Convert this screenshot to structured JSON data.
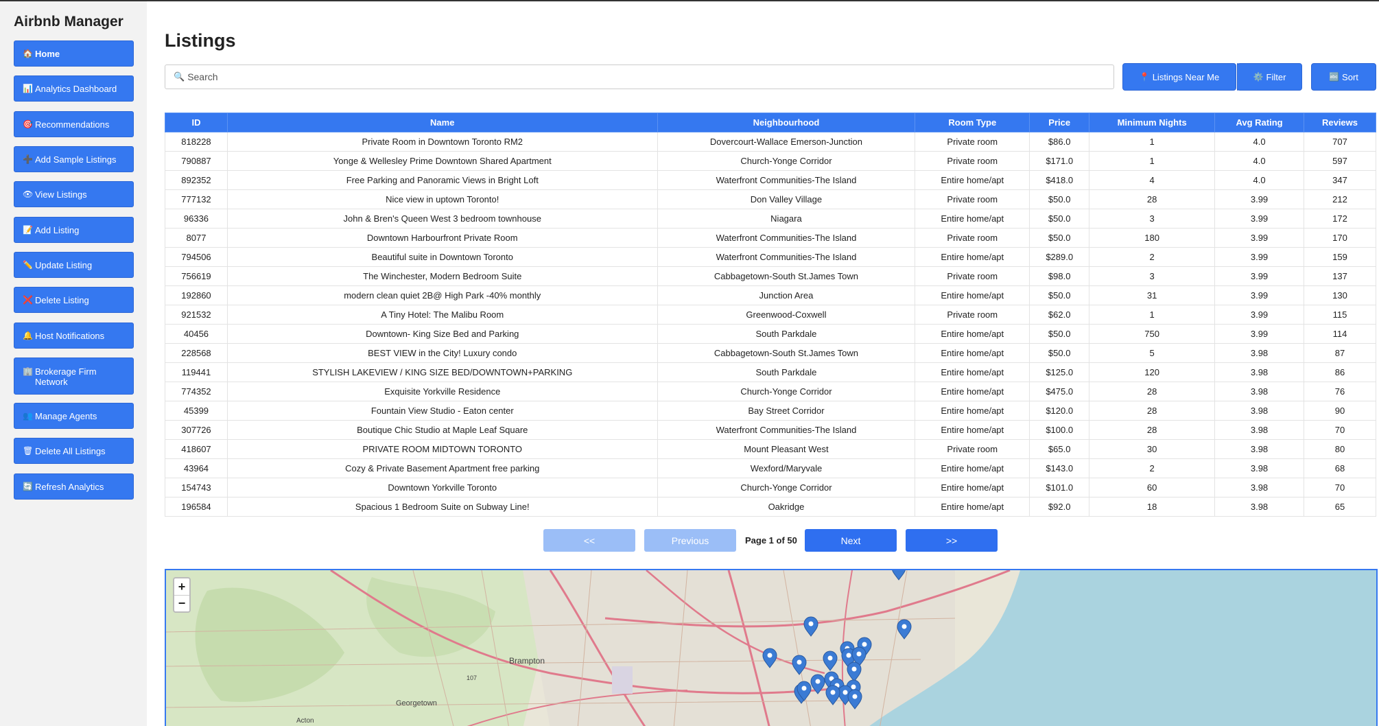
{
  "sidebar": {
    "title": "Airbnb Manager",
    "items": [
      {
        "icon": "🏠",
        "label": "Home"
      },
      {
        "icon": "📊",
        "label": "Analytics Dashboard"
      },
      {
        "icon": "🎯",
        "label": "Recommendations"
      },
      {
        "icon": "➕",
        "label": "Add Sample Listings"
      },
      {
        "icon": "👁",
        "label": "View Listings"
      },
      {
        "icon": "📝",
        "label": "Add Listing"
      },
      {
        "icon": "✏️",
        "label": "Update Listing"
      },
      {
        "icon": "❌",
        "label": "Delete Listing"
      },
      {
        "icon": "🔔",
        "label": "Host Notifications"
      },
      {
        "icon": "🏢",
        "label": "Brokerage Firm Network"
      },
      {
        "icon": "👥",
        "label": "Manage Agents"
      },
      {
        "icon": "🗑",
        "label": "Delete All Listings"
      },
      {
        "icon": "🔄",
        "label": "Refresh Analytics"
      }
    ]
  },
  "main": {
    "title": "Listings",
    "search": {
      "icon": "🔍",
      "placeholder": "Search"
    },
    "buttons": {
      "near_me": {
        "icon": "📍",
        "label": "Listings Near Me"
      },
      "filter": {
        "icon": "⚙️",
        "label": "Filter"
      },
      "sort": {
        "icon": "🔤",
        "label": "Sort"
      }
    }
  },
  "table": {
    "headers": [
      "ID",
      "Name",
      "Neighbourhood",
      "Room Type",
      "Price",
      "Minimum Nights",
      "Avg Rating",
      "Reviews"
    ],
    "rows": [
      [
        "818228",
        "Private Room in Downtown Toronto RM2",
        "Dovercourt-Wallace Emerson-Junction",
        "Private room",
        "$86.0",
        "1",
        "4.0",
        "707"
      ],
      [
        "790887",
        "Yonge & Wellesley Prime Downtown Shared Apartment",
        "Church-Yonge Corridor",
        "Private room",
        "$171.0",
        "1",
        "4.0",
        "597"
      ],
      [
        "892352",
        "Free Parking and Panoramic Views in Bright Loft",
        "Waterfront Communities-The Island",
        "Entire home/apt",
        "$418.0",
        "4",
        "4.0",
        "347"
      ],
      [
        "777132",
        "Nice view in uptown Toronto!",
        "Don Valley Village",
        "Private room",
        "$50.0",
        "28",
        "3.99",
        "212"
      ],
      [
        "96336",
        "John & Bren's Queen West 3 bedroom townhouse",
        "Niagara",
        "Entire home/apt",
        "$50.0",
        "3",
        "3.99",
        "172"
      ],
      [
        "8077",
        "Downtown Harbourfront Private Room",
        "Waterfront Communities-The Island",
        "Private room",
        "$50.0",
        "180",
        "3.99",
        "170"
      ],
      [
        "794506",
        "Beautiful suite in Downtown Toronto",
        "Waterfront Communities-The Island",
        "Entire home/apt",
        "$289.0",
        "2",
        "3.99",
        "159"
      ],
      [
        "756619",
        "The Winchester, Modern Bedroom Suite",
        "Cabbagetown-South St.James Town",
        "Private room",
        "$98.0",
        "3",
        "3.99",
        "137"
      ],
      [
        "192860",
        "modern clean quiet 2B@ High Park -40% monthly",
        "Junction Area",
        "Entire home/apt",
        "$50.0",
        "31",
        "3.99",
        "130"
      ],
      [
        "921532",
        "A Tiny Hotel: The Malibu Room",
        "Greenwood-Coxwell",
        "Private room",
        "$62.0",
        "1",
        "3.99",
        "115"
      ],
      [
        "40456",
        "Downtown- King Size Bed and Parking",
        "South Parkdale",
        "Entire home/apt",
        "$50.0",
        "750",
        "3.99",
        "114"
      ],
      [
        "228568",
        "BEST VIEW in the City! Luxury condo",
        "Cabbagetown-South St.James Town",
        "Entire home/apt",
        "$50.0",
        "5",
        "3.98",
        "87"
      ],
      [
        "119441",
        "STYLISH LAKEVIEW / KING SIZE BED/DOWNTOWN+PARKING",
        "South Parkdale",
        "Entire home/apt",
        "$125.0",
        "120",
        "3.98",
        "86"
      ],
      [
        "774352",
        "Exquisite Yorkville Residence",
        "Church-Yonge Corridor",
        "Entire home/apt",
        "$475.0",
        "28",
        "3.98",
        "76"
      ],
      [
        "45399",
        "Fountain View Studio - Eaton center",
        "Bay Street Corridor",
        "Entire home/apt",
        "$120.0",
        "28",
        "3.98",
        "90"
      ],
      [
        "307726",
        "Boutique Chic Studio at Maple Leaf Square",
        "Waterfront Communities-The Island",
        "Entire home/apt",
        "$100.0",
        "28",
        "3.98",
        "70"
      ],
      [
        "418607",
        "PRIVATE ROOM MIDTOWN TORONTO",
        "Mount Pleasant West",
        "Private room",
        "$65.0",
        "30",
        "3.98",
        "80"
      ],
      [
        "43964",
        "Cozy & Private Basement Apartment free parking",
        "Wexford/Maryvale",
        "Entire home/apt",
        "$143.0",
        "2",
        "3.98",
        "68"
      ],
      [
        "154743",
        "Downtown Yorkville Toronto",
        "Church-Yonge Corridor",
        "Entire home/apt",
        "$101.0",
        "60",
        "3.98",
        "70"
      ],
      [
        "196584",
        "Spacious 1 Bedroom Suite on Subway Line!",
        "Oakridge",
        "Entire home/apt",
        "$92.0",
        "18",
        "3.98",
        "65"
      ]
    ]
  },
  "pagination": {
    "first": "<<",
    "previous": "Previous",
    "indicator": "Page 1 of 50",
    "next": "Next",
    "last": ">>"
  },
  "map": {
    "zoom_in": "+",
    "zoom_out": "−",
    "labels": [
      "Brampton",
      "Georgetown",
      "Acton",
      "107"
    ],
    "marker_count": 20,
    "marker_color": "#3b7bd4",
    "water_color": "#aad3df"
  }
}
